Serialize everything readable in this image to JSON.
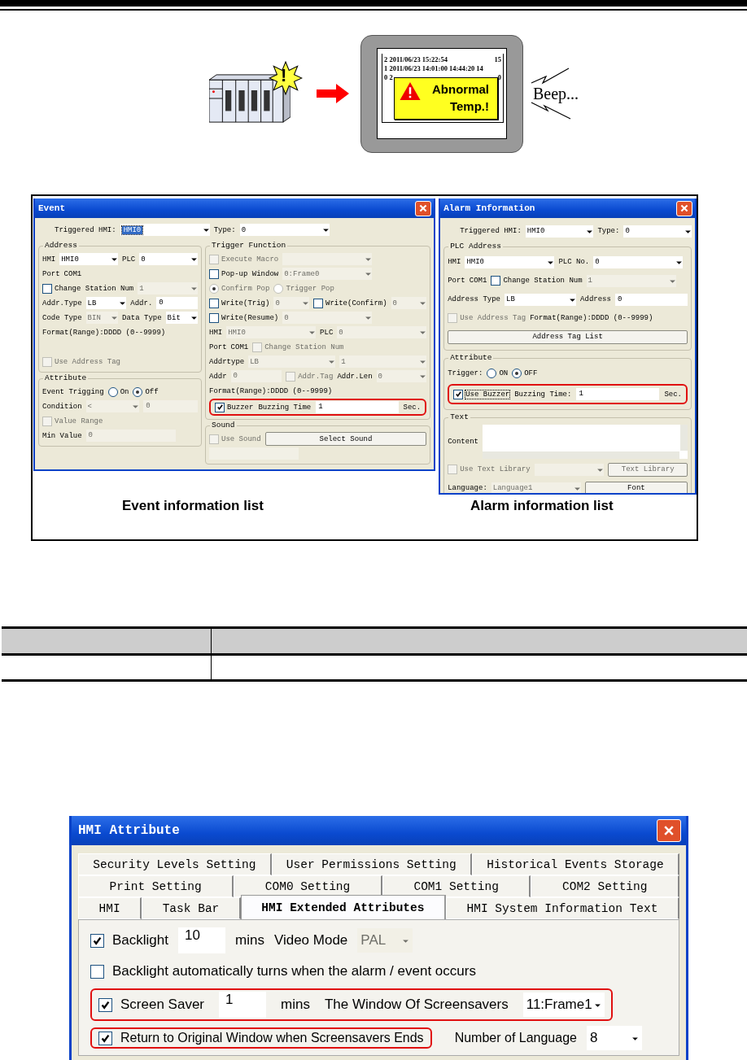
{
  "illustration": {
    "badge_symbol": "!",
    "log_lines": [
      {
        "text": "2 2011/06/23 15:22:54",
        "end": "15"
      },
      {
        "text": "1 2011/06/23 14:01:00 14:44:20 14"
      },
      {
        "text": "0 2",
        "end": "0"
      }
    ],
    "alert_message": "Abnormal Temp.!",
    "sound": "Beep..."
  },
  "event_dialog": {
    "title": "Event",
    "top_row": {
      "items": [
        {
          "kind": "label",
          "text": "Triggered HMI:"
        },
        {
          "kind": "dropdown",
          "value": "HMI0",
          "focused": true
        },
        {
          "kind": "label",
          "text": "Type:"
        },
        {
          "kind": "dropdown",
          "value": "0"
        }
      ]
    },
    "left_groups": [
      {
        "legend": "Address",
        "rows": [
          {
            "items": [
              {
                "kind": "label",
                "text": "HMI"
              },
              {
                "kind": "dropdown",
                "value": "HMI0"
              },
              {
                "kind": "label",
                "text": "PLC"
              },
              {
                "kind": "dropdown",
                "value": "0"
              }
            ]
          },
          {
            "items": [
              {
                "kind": "label",
                "text": "Port"
              },
              {
                "kind": "label",
                "text": "COM1"
              }
            ]
          },
          {
            "items": [
              {
                "kind": "check",
                "label": "Change Station Num",
                "checked": false
              },
              {
                "kind": "dropdown",
                "value": "1",
                "disabled": true
              }
            ]
          },
          {
            "items": [
              {
                "kind": "label",
                "text": "Addr.Type"
              },
              {
                "kind": "dropdown",
                "value": "LB"
              },
              {
                "kind": "label",
                "text": "Addr."
              },
              {
                "kind": "field",
                "value": "0"
              }
            ]
          },
          {
            "items": [
              {
                "kind": "label",
                "text": "Code Type"
              },
              {
                "kind": "dropdown",
                "value": "BIN",
                "disabled": true
              },
              {
                "kind": "label",
                "text": "Data Type"
              },
              {
                "kind": "dropdown",
                "value": "Bit"
              }
            ]
          },
          {
            "items": [
              {
                "kind": "label",
                "text": "Format(Range):DDDD  (0--9999)"
              }
            ]
          },
          {
            "items": []
          },
          {
            "items": [
              {
                "kind": "check",
                "label": "Use Address Tag",
                "checked": false,
                "disabled": true
              }
            ]
          }
        ]
      },
      {
        "legend": "Attribute",
        "rows": [
          {
            "items": [
              {
                "kind": "label",
                "text": "Event Trigging"
              },
              {
                "kind": "radio",
                "label": "On",
                "selected": false
              },
              {
                "kind": "radio",
                "label": "Off",
                "selected": true
              }
            ]
          },
          {
            "items": [
              {
                "kind": "label",
                "text": "Condition"
              },
              {
                "kind": "dropdown",
                "value": "<",
                "disabled": true
              },
              {
                "kind": "field",
                "value": "0",
                "disabled": true
              }
            ]
          },
          {
            "items": [
              {
                "kind": "check",
                "label": "Value Range",
                "checked": false,
                "disabled": true
              }
            ]
          },
          {
            "items": [
              {
                "kind": "label",
                "text": "Min Value"
              },
              {
                "kind": "field",
                "value": "0",
                "disabled": true
              }
            ]
          }
        ]
      }
    ],
    "right_groups": [
      {
        "legend": "Trigger Function",
        "rows": [
          {
            "items": [
              {
                "kind": "check",
                "label": "Execute Macro",
                "checked": false,
                "disabled": true
              },
              {
                "kind": "dropdown",
                "disabled": true
              }
            ]
          },
          {
            "items": [
              {
                "kind": "check",
                "label": "Pop-up Window",
                "checked": false
              },
              {
                "kind": "dropdown",
                "value": "0:Frame0",
                "disabled": true
              }
            ]
          },
          {
            "items": [
              {
                "kind": "radio",
                "label": "Confirm Pop",
                "selected": true,
                "disabled": true
              },
              {
                "kind": "radio",
                "label": "Trigger Pop",
                "selected": false,
                "disabled": true
              }
            ]
          },
          {
            "items": [
              {
                "kind": "check",
                "label": "Write(Trig)",
                "checked": false
              },
              {
                "kind": "dropdown",
                "value": "0",
                "disabled": true
              },
              {
                "kind": "check",
                "label": "Write(Confirm)",
                "checked": false
              },
              {
                "kind": "dropdown",
                "value": "0",
                "disabled": true
              }
            ]
          },
          {
            "items": [
              {
                "kind": "check",
                "label": "Write(Resume)",
                "checked": false
              },
              {
                "kind": "dropdown",
                "value": "0",
                "disabled": true
              }
            ]
          },
          {
            "items": [
              {
                "kind": "label",
                "text": "HMI"
              },
              {
                "kind": "dropdown",
                "value": "HMI0",
                "disabled": true
              },
              {
                "kind": "label",
                "text": "PLC"
              },
              {
                "kind": "dropdown",
                "value": "0",
                "disabled": true
              }
            ]
          },
          {
            "items": [
              {
                "kind": "label",
                "text": "Port"
              },
              {
                "kind": "label",
                "text": "COM1"
              },
              {
                "kind": "check",
                "label": "Change Station Num",
                "checked": false,
                "disabled": true
              }
            ]
          },
          {
            "items": [
              {
                "kind": "label",
                "text": "Addrtype"
              },
              {
                "kind": "dropdown",
                "value": "LB",
                "disabled": true
              },
              {
                "kind": "dropdown",
                "value": "1",
                "disabled": true
              }
            ]
          },
          {
            "items": [
              {
                "kind": "label",
                "text": "Addr"
              },
              {
                "kind": "field",
                "value": "0",
                "disabled": true
              },
              {
                "kind": "check",
                "label": "Addr.Tag",
                "checked": false,
                "disabled": true
              },
              {
                "kind": "label",
                "text": "Addr.Len"
              },
              {
                "kind": "dropdown",
                "value": "0",
                "disabled": true
              }
            ]
          },
          {
            "items": [
              {
                "kind": "label",
                "text": "Format(Range):DDDD  (0--9999)"
              }
            ]
          },
          {
            "items": [
              {
                "kind": "frame",
                "items": [
                  {
                    "kind": "check",
                    "label": "Buzzer",
                    "checked": true
                  },
                  {
                    "kind": "label",
                    "text": "Buzzing Time"
                  },
                  {
                    "kind": "field",
                    "value": "1"
                  },
                  {
                    "kind": "label",
                    "text": "Sec."
                  }
                ]
              }
            ]
          }
        ]
      },
      {
        "legend": "Sound",
        "rows": [
          {
            "items": [
              {
                "kind": "check",
                "label": "Use Sound",
                "checked": false,
                "disabled": true
              },
              {
                "kind": "button",
                "label": "Select Sound"
              }
            ]
          },
          {
            "items": [
              {
                "kind": "field",
                "disabled": true
              }
            ]
          }
        ]
      }
    ],
    "caption": "Event information list"
  },
  "alarm_dialog": {
    "title": "Alarm Information",
    "top_row": {
      "items": [
        {
          "kind": "label",
          "text": "Triggered HMI:"
        },
        {
          "kind": "dropdown",
          "value": "HMI0"
        },
        {
          "kind": "label",
          "text": "Type:"
        },
        {
          "kind": "dropdown",
          "value": "0"
        }
      ]
    },
    "groups": [
      {
        "legend": "PLC Address",
        "rows": [
          {
            "items": [
              {
                "kind": "label",
                "text": "HMI"
              },
              {
                "kind": "dropdown",
                "value": "HMI0"
              },
              {
                "kind": "label",
                "text": "PLC No."
              },
              {
                "kind": "dropdown",
                "value": "0"
              }
            ]
          },
          {
            "items": [
              {
                "kind": "label",
                "text": "Port"
              },
              {
                "kind": "label",
                "text": "COM1"
              },
              {
                "kind": "check",
                "label": "Change Station Num",
                "checked": false
              },
              {
                "kind": "dropdown",
                "value": "1",
                "disabled": true
              }
            ]
          },
          {
            "items": [
              {
                "kind": "label",
                "text": "Address Type"
              },
              {
                "kind": "dropdown",
                "value": "LB"
              },
              {
                "kind": "label",
                "text": "Address"
              },
              {
                "kind": "field",
                "value": "0"
              }
            ]
          },
          {
            "items": [
              {
                "kind": "check",
                "label": "Use Address Tag",
                "checked": false,
                "disabled": true
              },
              {
                "kind": "label",
                "text": "Format(Range):DDDD (0--9999)"
              }
            ]
          },
          {
            "items": [
              {
                "kind": "button",
                "label": "Address Tag List"
              }
            ]
          }
        ]
      },
      {
        "legend": "Attribute",
        "rows": [
          {
            "items": [
              {
                "kind": "label",
                "text": "Trigger:"
              },
              {
                "kind": "radio",
                "label": "ON",
                "selected": false
              },
              {
                "kind": "radio",
                "label": "OFF",
                "selected": true
              }
            ]
          },
          {
            "items": [
              {
                "kind": "frame",
                "items": [
                  {
                    "kind": "check",
                    "label": "Use Buzzer",
                    "checked": true,
                    "focused": true
                  },
                  {
                    "kind": "label",
                    "text": "Buzzing Time:"
                  },
                  {
                    "kind": "field",
                    "value": "1"
                  },
                  {
                    "kind": "label",
                    "text": "Sec."
                  }
                ]
              }
            ]
          }
        ]
      },
      {
        "legend": "Text",
        "rows": [
          {
            "items": [
              {
                "kind": "label",
                "text": "Content"
              },
              {
                "kind": "textarea"
              }
            ]
          },
          {
            "items": [
              {
                "kind": "check",
                "label": "Use Text Library",
                "checked": false,
                "disabled": true
              },
              {
                "kind": "dropdown",
                "disabled": true
              },
              {
                "kind": "button",
                "label": "Text Library",
                "disabled": true
              }
            ]
          },
          {
            "items": [
              {
                "kind": "label",
                "text": "Language:"
              },
              {
                "kind": "dropdown",
                "value": "Language1",
                "disabled": true
              },
              {
                "kind": "button",
                "label": "Font"
              }
            ]
          }
        ]
      }
    ],
    "caption": "Alarm information list"
  },
  "hmi_attribute": {
    "title": "HMI Attribute",
    "tab_rows": [
      [
        {
          "label": "Security Levels Setting",
          "selected": false
        },
        {
          "label": "User Permissions Setting",
          "selected": false
        },
        {
          "label": "Historical Events Storage",
          "selected": false
        }
      ],
      [
        {
          "label": "Print Setting",
          "selected": false
        },
        {
          "label": "COM0 Setting",
          "selected": false
        },
        {
          "label": "COM1 Setting",
          "selected": false
        },
        {
          "label": "COM2 Setting",
          "selected": false
        }
      ],
      [
        {
          "label": "HMI",
          "selected": false
        },
        {
          "label": "Task Bar",
          "selected": false
        },
        {
          "label": "HMI Extended Attributes",
          "selected": true
        },
        {
          "label": "HMI System Information Text",
          "selected": false
        }
      ]
    ],
    "rows": [
      {
        "items": [
          {
            "kind": "check",
            "label": "Backlight",
            "checked": true
          },
          {
            "kind": "field",
            "value": "10"
          },
          {
            "kind": "label",
            "text": "mins"
          },
          {
            "kind": "label",
            "text": "Video Mode"
          },
          {
            "kind": "dropdown",
            "value": "PAL",
            "disabled": true
          }
        ]
      },
      {
        "items": [
          {
            "kind": "check",
            "label": "Backlight automatically turns when the alarm / event occurs",
            "checked": false
          }
        ]
      },
      {
        "items": [
          {
            "kind": "frame",
            "items": [
              {
                "kind": "check",
                "label": "Screen Saver",
                "checked": true
              },
              {
                "kind": "field",
                "value": "1"
              },
              {
                "kind": "label",
                "text": "mins"
              },
              {
                "kind": "label",
                "text": "The Window Of Screensavers"
              },
              {
                "kind": "dropdown",
                "value": "11:Frame1"
              }
            ]
          }
        ]
      },
      {
        "items": [
          {
            "kind": "frame",
            "items": [
              {
                "kind": "check",
                "label": "Return to Original Window when Screensavers Ends",
                "checked": true
              }
            ]
          },
          {
            "kind": "label",
            "text": "Number of Language"
          },
          {
            "kind": "dropdown",
            "value": "8"
          }
        ]
      }
    ]
  }
}
